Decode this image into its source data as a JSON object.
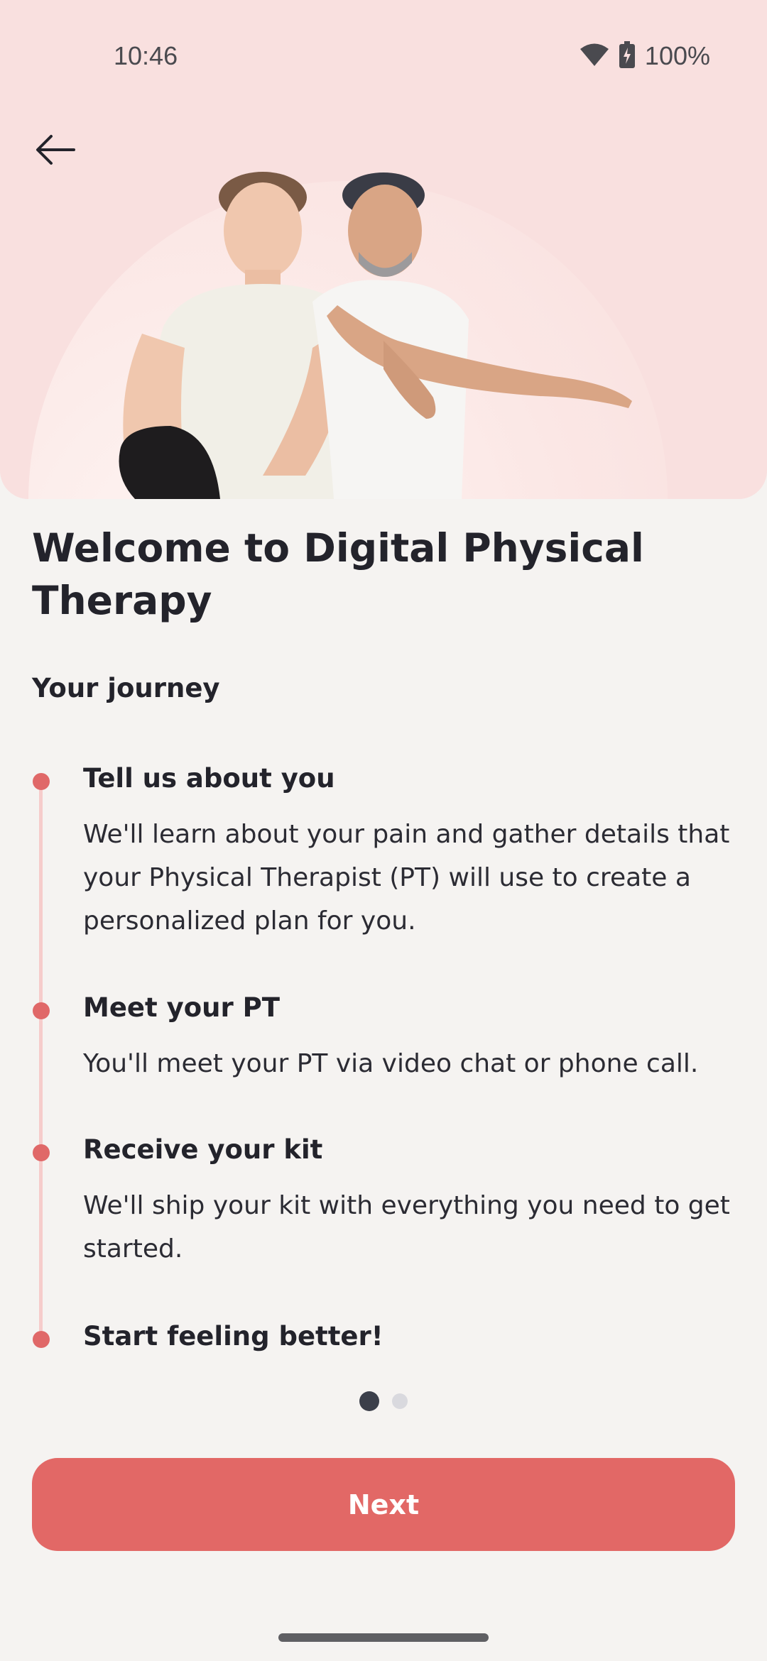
{
  "status_bar": {
    "time": "10:46",
    "battery": "100%"
  },
  "hero": {
    "image_alt": "Two people stretching"
  },
  "content": {
    "title": "Welcome to Digital Physical Therapy",
    "subtitle": "Your journey",
    "steps": [
      {
        "title": "Tell us about you",
        "description": "We'll learn about your pain and gather details that your Physical Therapist (PT) will use to create a personalized plan for you."
      },
      {
        "title": "Meet your PT",
        "description": "You'll meet your PT via video chat or phone call."
      },
      {
        "title": "Receive your kit",
        "description": "We'll ship your kit with everything you need to get started."
      },
      {
        "title": "Start feeling better!",
        "description": ""
      }
    ]
  },
  "pager": {
    "current": 1,
    "total": 2
  },
  "footer": {
    "next_label": "Next"
  },
  "colors": {
    "accent": "#e26866",
    "hero_bg": "#f9e0df",
    "page_bg": "#f5f3f1",
    "timeline": "#f6cccb"
  },
  "icons": {
    "back": "arrow-left-icon",
    "wifi": "wifi-icon",
    "battery": "battery-charging-icon"
  }
}
